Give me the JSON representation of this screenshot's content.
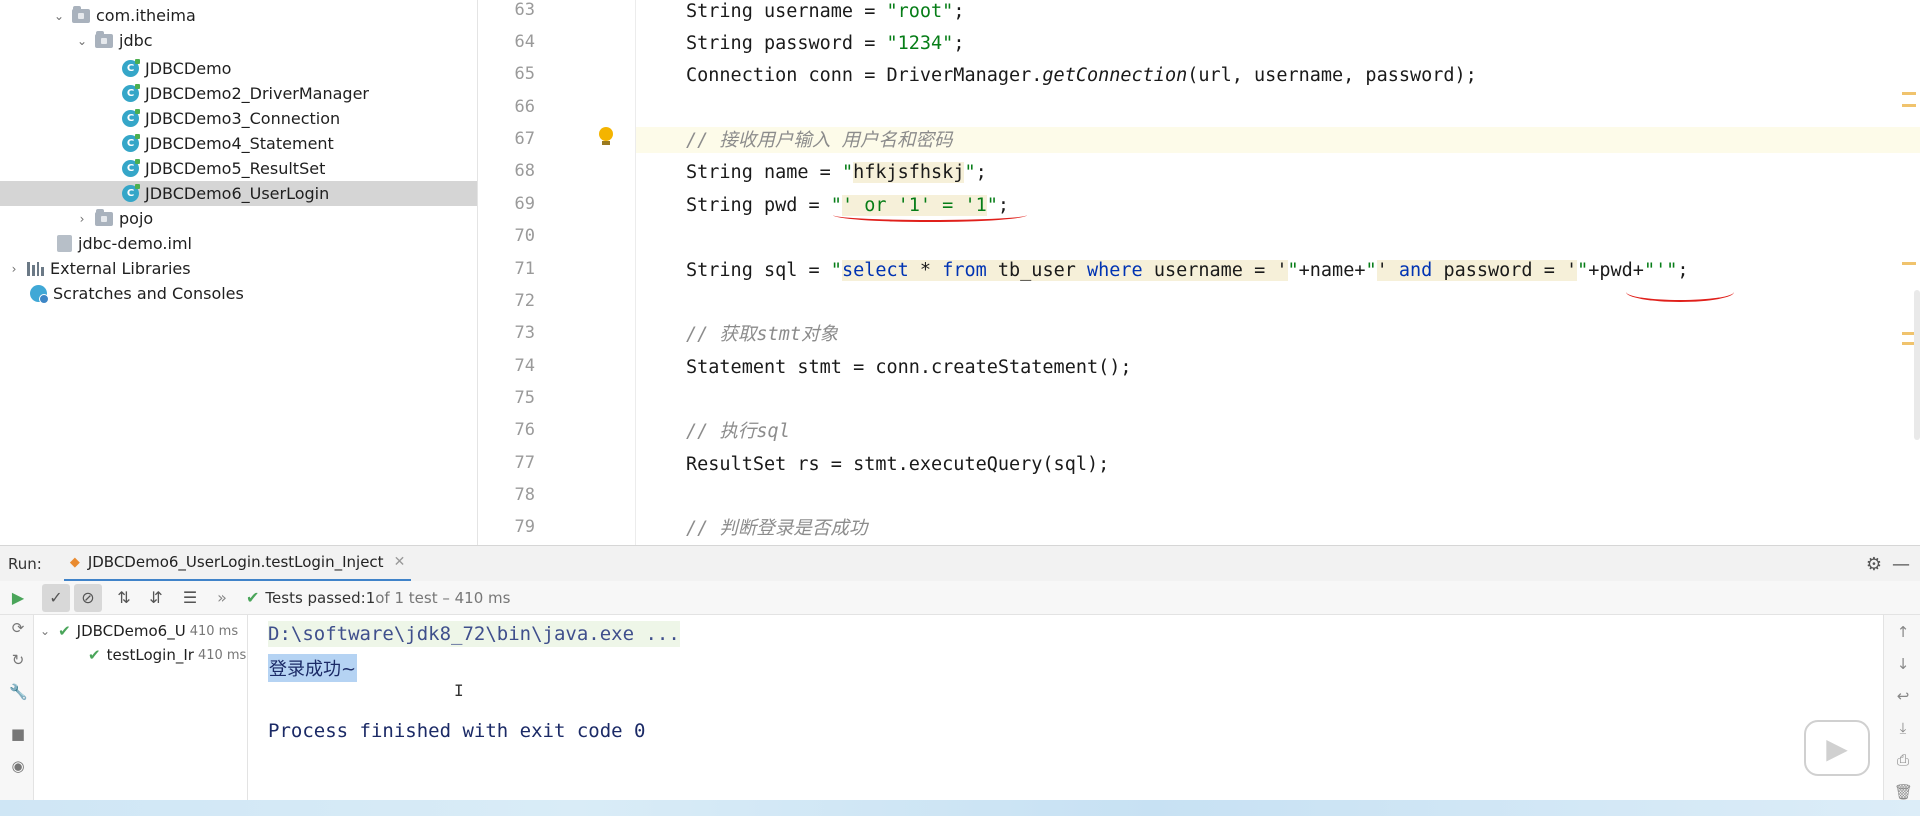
{
  "tree": {
    "items": [
      {
        "label": "com.itheima",
        "kind": "package"
      },
      {
        "label": "jdbc",
        "kind": "package"
      },
      {
        "label": "JDBCDemo",
        "kind": "class"
      },
      {
        "label": "JDBCDemo2_DriverManager",
        "kind": "class"
      },
      {
        "label": "JDBCDemo3_Connection",
        "kind": "class"
      },
      {
        "label": "JDBCDemo4_Statement",
        "kind": "class"
      },
      {
        "label": "JDBCDemo5_ResultSet",
        "kind": "class"
      },
      {
        "label": "JDBCDemo6_UserLogin",
        "kind": "class",
        "selected": true
      },
      {
        "label": "pojo",
        "kind": "package"
      },
      {
        "label": "jdbc-demo.iml",
        "kind": "file"
      },
      {
        "label": "External Libraries",
        "kind": "libraries"
      },
      {
        "label": "Scratches and Consoles",
        "kind": "scratches"
      }
    ]
  },
  "editor": {
    "line_numbers": [
      "63",
      "64",
      "65",
      "66",
      "67",
      "68",
      "69",
      "70",
      "71",
      "72",
      "73",
      "74",
      "75",
      "76",
      "77",
      "78",
      "79"
    ],
    "lines": {
      "l63": {
        "a": "String username = ",
        "s": "\"root\"",
        "b": ";"
      },
      "l64": {
        "a": "String password = ",
        "s": "\"1234\"",
        "b": ";"
      },
      "l65": {
        "a": "Connection conn = DriverManager.",
        "f": "getConnection",
        "b": "(url, username, password);"
      },
      "l67": {
        "c": "// 接收用户输入 用户名和密码"
      },
      "l68": {
        "a": "String name = ",
        "q1": "\"",
        "s": "hfkjsfhskj",
        "q2": "\"",
        "b": ";"
      },
      "l69": {
        "a": "String pwd = ",
        "q1": "\"",
        "s": "' or '1' = '1",
        "q2": "\"",
        "b": ";"
      },
      "l71": {
        "a": "String sql = ",
        "q": "\"",
        "k1": "select",
        "t1": " * ",
        "k2": "from",
        "t2": " tb_user ",
        "k3": "where",
        "t3": " username = '",
        "q2": "\"",
        "mid1": "+name+",
        "q3": "\"",
        "t4": "' ",
        "k4": "and",
        "t5": " password = '",
        "q4": "\"",
        "mid2": "+pwd+",
        "t6": "\"'\"",
        "b": ";"
      },
      "l73": {
        "c": "// 获取stmt对象"
      },
      "l74": {
        "a": "Statement stmt = conn.createStatement();"
      },
      "l76": {
        "c": "// 执行sql"
      },
      "l77": {
        "a": "ResultSet rs = stmt.executeQuery(sql);"
      },
      "l79": {
        "c": "// 判断登录是否成功"
      }
    }
  },
  "run": {
    "label": "Run:",
    "tab_title": "JDBCDemo6_UserLogin.testLogin_Inject",
    "status": {
      "prefix": "Tests passed: ",
      "count": "1",
      "suffix": " of 1 test – 410 ms"
    },
    "test_tree": [
      {
        "label": "JDBCDemo6_U",
        "time": "410 ms"
      },
      {
        "label": "testLogin_Ir",
        "time": "410 ms"
      }
    ],
    "console": {
      "command": "D:\\software\\jdk8_72\\bin\\java.exe ...",
      "output": "登录成功~",
      "exit": "Process finished with exit code 0"
    }
  },
  "colors": {
    "string": "#067d17",
    "keyword": "#0033b3",
    "comment": "#8c8c8c",
    "underline": "#e0201b",
    "tab_accent": "#4083c9"
  }
}
